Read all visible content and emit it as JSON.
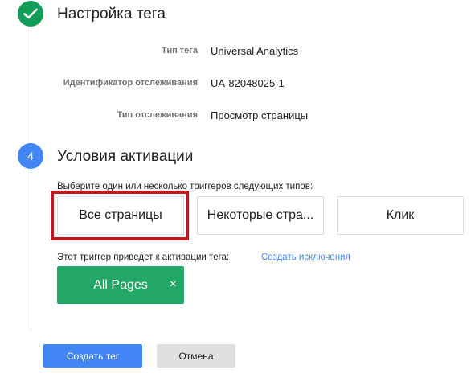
{
  "step_tag_setup": {
    "title": "Настройка тега",
    "fields": [
      {
        "label": "Тип тега",
        "value": "Universal Analytics"
      },
      {
        "label": "Идентификатор отслеживания",
        "value": "UA-82048025-1"
      },
      {
        "label": "Тип отслеживания",
        "value": "Просмотр страницы"
      }
    ]
  },
  "step_triggers": {
    "number": "4",
    "title": "Условия активации",
    "hint": "Выберите один или несколько триггеров следующих типов:",
    "trigger_types": [
      {
        "label": "Все страницы",
        "highlighted": true
      },
      {
        "label": "Некоторые стра..."
      },
      {
        "label": "Клик"
      }
    ],
    "activation_text": "Этот триггер приведет к активации тега:",
    "exception_link": "Создать исключения",
    "selected_trigger": {
      "label": "All Pages",
      "close_glyph": "×"
    }
  },
  "actions": {
    "create": "Создать тег",
    "cancel": "Отмена"
  },
  "colors": {
    "success": "#0f9d58",
    "step_active": "#4285f4",
    "chip": "#22a766",
    "highlight": "#c4161c",
    "link": "#4285f4"
  },
  "icons": {
    "step_complete": "check-icon",
    "chip_remove": "close-icon"
  }
}
